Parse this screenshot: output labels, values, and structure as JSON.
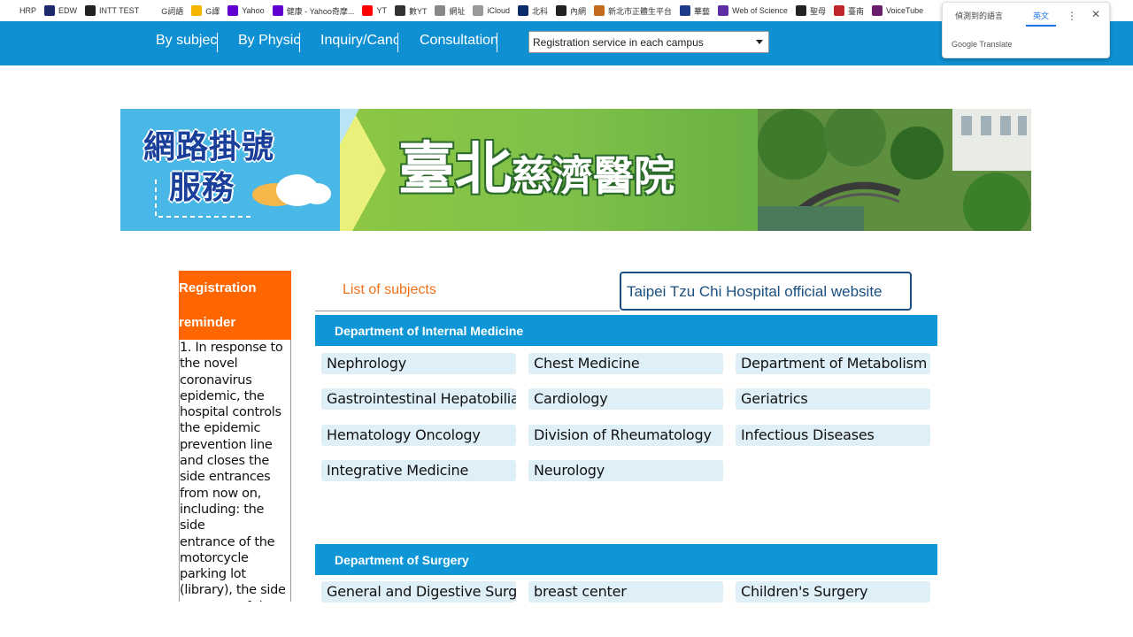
{
  "bookmarks": [
    {
      "label": "HRP",
      "color": "#ffffff"
    },
    {
      "label": "EDW",
      "color": "#1e2a6b"
    },
    {
      "label": "INTT TEST",
      "color": "#222222"
    },
    {
      "label": "G詞語",
      "color": "#ffffff"
    },
    {
      "label": "G譯",
      "color": "#f4b400"
    },
    {
      "label": "Yahoo",
      "color": "#6001d2"
    },
    {
      "label": "健康 - Yahoo奇摩...",
      "color": "#6001d2"
    },
    {
      "label": "YT",
      "color": "#ff0000"
    },
    {
      "label": "數YT",
      "color": "#333333"
    },
    {
      "label": "網址",
      "color": "#888888"
    },
    {
      "label": "iCloud",
      "color": "#999999"
    },
    {
      "label": "北科",
      "color": "#0a2c6b"
    },
    {
      "label": "內網",
      "color": "#222222"
    },
    {
      "label": "新北市正體生平台",
      "color": "#c46a1c"
    },
    {
      "label": "華藝",
      "color": "#1e3a8a"
    },
    {
      "label": "Web of Science",
      "color": "#5e2ca5"
    },
    {
      "label": "聖母",
      "color": "#222222"
    },
    {
      "label": "臺南",
      "color": "#c0272d"
    },
    {
      "label": "VoiceTube",
      "color": "#6b1e6b"
    }
  ],
  "translate": {
    "detected": "偵測到的語言",
    "english": "英文",
    "footer": "Google Translate"
  },
  "nav": {
    "items": [
      "By subject",
      "By Physician",
      "Inquiry/Cancel",
      "Consultation"
    ],
    "select_value": "Registration service in each campus"
  },
  "banner": {
    "left_title_line1": "網路掛號",
    "left_title_line2": "服務",
    "hospital_name_big": "臺北",
    "hospital_name_small": "慈濟醫院"
  },
  "reminder": {
    "title_line1": "Registration",
    "title_line2": "reminder",
    "body_lines": [
      "1. In response to",
      "the novel",
      "coronavirus",
      "epidemic, the",
      "hospital controls",
      "the epidemic",
      "prevention line",
      "and closes the",
      "side entrances",
      "from now on,",
      "including: the side",
      "entrance of the",
      "motorcycle",
      "parking lot",
      "(library), the side",
      "entrance of the"
    ]
  },
  "tabs": {
    "subjects": "List of subjects",
    "official": "Taipei Tzu Chi Hospital official website"
  },
  "departments": [
    {
      "title": "Department of Internal Medicine",
      "items": [
        "Nephrology",
        "Chest Medicine",
        "Department of Metabolism and Endocrinology",
        "Gastrointestinal Hepatobiliary",
        "Cardiology",
        "Geriatrics",
        "Hematology Oncology",
        "Division of Rheumatology",
        "Infectious Diseases",
        "Integrative Medicine",
        "Neurology"
      ]
    },
    {
      "title": "Department of Surgery",
      "items": [
        "General and Digestive Surgery",
        "breast center",
        "Children's Surgery"
      ]
    }
  ]
}
